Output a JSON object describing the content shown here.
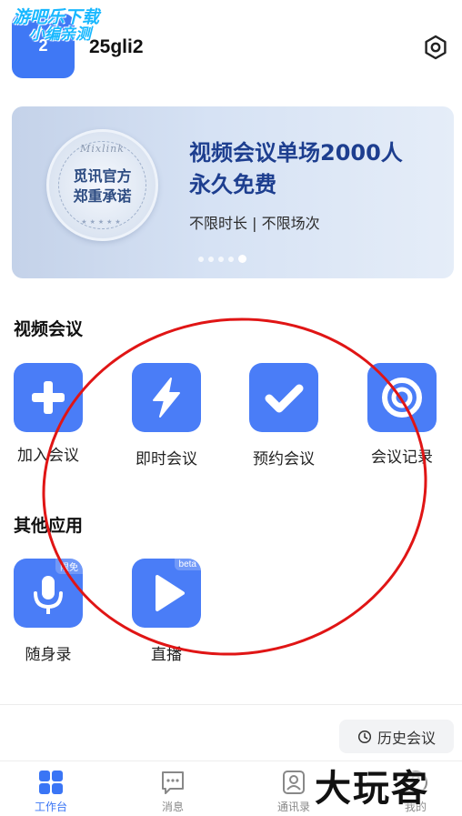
{
  "header": {
    "avatar_text": "2",
    "username": "25gli2",
    "watermark_line1": "游吧乐下载",
    "watermark_line2": "小编亲测"
  },
  "banner": {
    "seal_brand": "Mixlink",
    "seal_promise": "觅讯官方\n郑重承诺",
    "headline": "视频会议单场2000人\n永久免费",
    "subline": "不限时长 | 不限场次",
    "carousel_count": 5,
    "carousel_active_index": 4
  },
  "video_meeting": {
    "title": "视频会议",
    "items": [
      {
        "label": "加入会议",
        "icon": "plus-icon"
      },
      {
        "label": "即时会议",
        "icon": "lightning-icon"
      },
      {
        "label": "预约会议",
        "icon": "check-icon"
      },
      {
        "label": "会议记录",
        "icon": "record-icon"
      }
    ]
  },
  "other_apps": {
    "title": "其他应用",
    "items": [
      {
        "label": "随身录",
        "icon": "microphone-icon",
        "tag": "限免"
      },
      {
        "label": "直播",
        "icon": "play-icon",
        "tag": "beta"
      }
    ]
  },
  "history_button": {
    "label": "历史会议",
    "icon": "clock-icon"
  },
  "tabbar": {
    "tabs": [
      {
        "label": "工作台",
        "icon": "grid-icon",
        "active": true
      },
      {
        "label": "消息",
        "icon": "chat-icon",
        "active": false
      },
      {
        "label": "通讯录",
        "icon": "contacts-icon",
        "active": false
      },
      {
        "label": "我的",
        "icon": "profile-icon",
        "active": false
      }
    ]
  },
  "overlay_brand": "大玩客",
  "colors": {
    "accent": "#3A75F5",
    "tile": "#4A7DF7",
    "annotation": "#E01515",
    "headline": "#1D3E8F"
  }
}
